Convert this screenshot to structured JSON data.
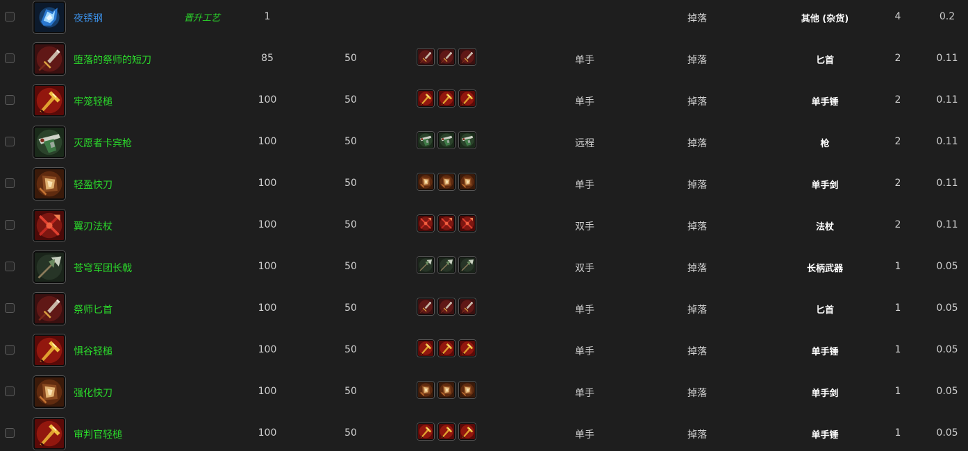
{
  "rows": [
    {
      "name": "夜锈钢",
      "quality": "blue",
      "tag": "晋升工艺",
      "level": "1",
      "req": "",
      "slot": "",
      "source": "掉落",
      "type": "其他 (杂货)",
      "count": "4",
      "pct": "0.2",
      "icon": "ore-icon",
      "minis": 0
    },
    {
      "name": "堕落的祭师的短刀",
      "quality": "green",
      "tag": "",
      "level": "85",
      "req": "50",
      "slot": "单手",
      "source": "掉落",
      "type": "匕首",
      "count": "2",
      "pct": "0.11",
      "icon": "dagger-icon",
      "minis": 3
    },
    {
      "name": "牢笼轻槌",
      "quality": "green",
      "tag": "",
      "level": "100",
      "req": "50",
      "slot": "单手",
      "source": "掉落",
      "type": "单手锤",
      "count": "2",
      "pct": "0.11",
      "icon": "mace-icon",
      "minis": 3
    },
    {
      "name": "灭愿者卡宾枪",
      "quality": "green",
      "tag": "",
      "level": "100",
      "req": "50",
      "slot": "远程",
      "source": "掉落",
      "type": "枪",
      "count": "2",
      "pct": "0.11",
      "icon": "gun-icon",
      "minis": 3
    },
    {
      "name": "轻盈快刀",
      "quality": "green",
      "tag": "",
      "level": "100",
      "req": "50",
      "slot": "单手",
      "source": "掉落",
      "type": "单手剑",
      "count": "2",
      "pct": "0.11",
      "icon": "sword-icon",
      "minis": 3
    },
    {
      "name": "翼刃法杖",
      "quality": "green",
      "tag": "",
      "level": "100",
      "req": "50",
      "slot": "双手",
      "source": "掉落",
      "type": "法杖",
      "count": "2",
      "pct": "0.11",
      "icon": "staff-icon",
      "minis": 3
    },
    {
      "name": "苍穹军团长戟",
      "quality": "green",
      "tag": "",
      "level": "100",
      "req": "50",
      "slot": "双手",
      "source": "掉落",
      "type": "长柄武器",
      "count": "1",
      "pct": "0.05",
      "icon": "polearm-icon",
      "minis": 3
    },
    {
      "name": "祭师匕首",
      "quality": "green",
      "tag": "",
      "level": "100",
      "req": "50",
      "slot": "单手",
      "source": "掉落",
      "type": "匕首",
      "count": "1",
      "pct": "0.05",
      "icon": "dagger-icon",
      "minis": 3
    },
    {
      "name": "惧谷轻槌",
      "quality": "green",
      "tag": "",
      "level": "100",
      "req": "50",
      "slot": "单手",
      "source": "掉落",
      "type": "单手锤",
      "count": "1",
      "pct": "0.05",
      "icon": "mace-icon",
      "minis": 3
    },
    {
      "name": "强化快刀",
      "quality": "green",
      "tag": "",
      "level": "100",
      "req": "50",
      "slot": "单手",
      "source": "掉落",
      "type": "单手剑",
      "count": "1",
      "pct": "0.05",
      "icon": "sword-icon",
      "minis": 3
    },
    {
      "name": "审判官轻槌",
      "quality": "green",
      "tag": "",
      "level": "100",
      "req": "50",
      "slot": "单手",
      "source": "掉落",
      "type": "单手锤",
      "count": "1",
      "pct": "0.05",
      "icon": "mace-icon",
      "minis": 3
    }
  ],
  "colors": {
    "blue_quality": "#3a8ce0",
    "green_quality": "#2bd92b",
    "background": "#1e1e1e"
  }
}
